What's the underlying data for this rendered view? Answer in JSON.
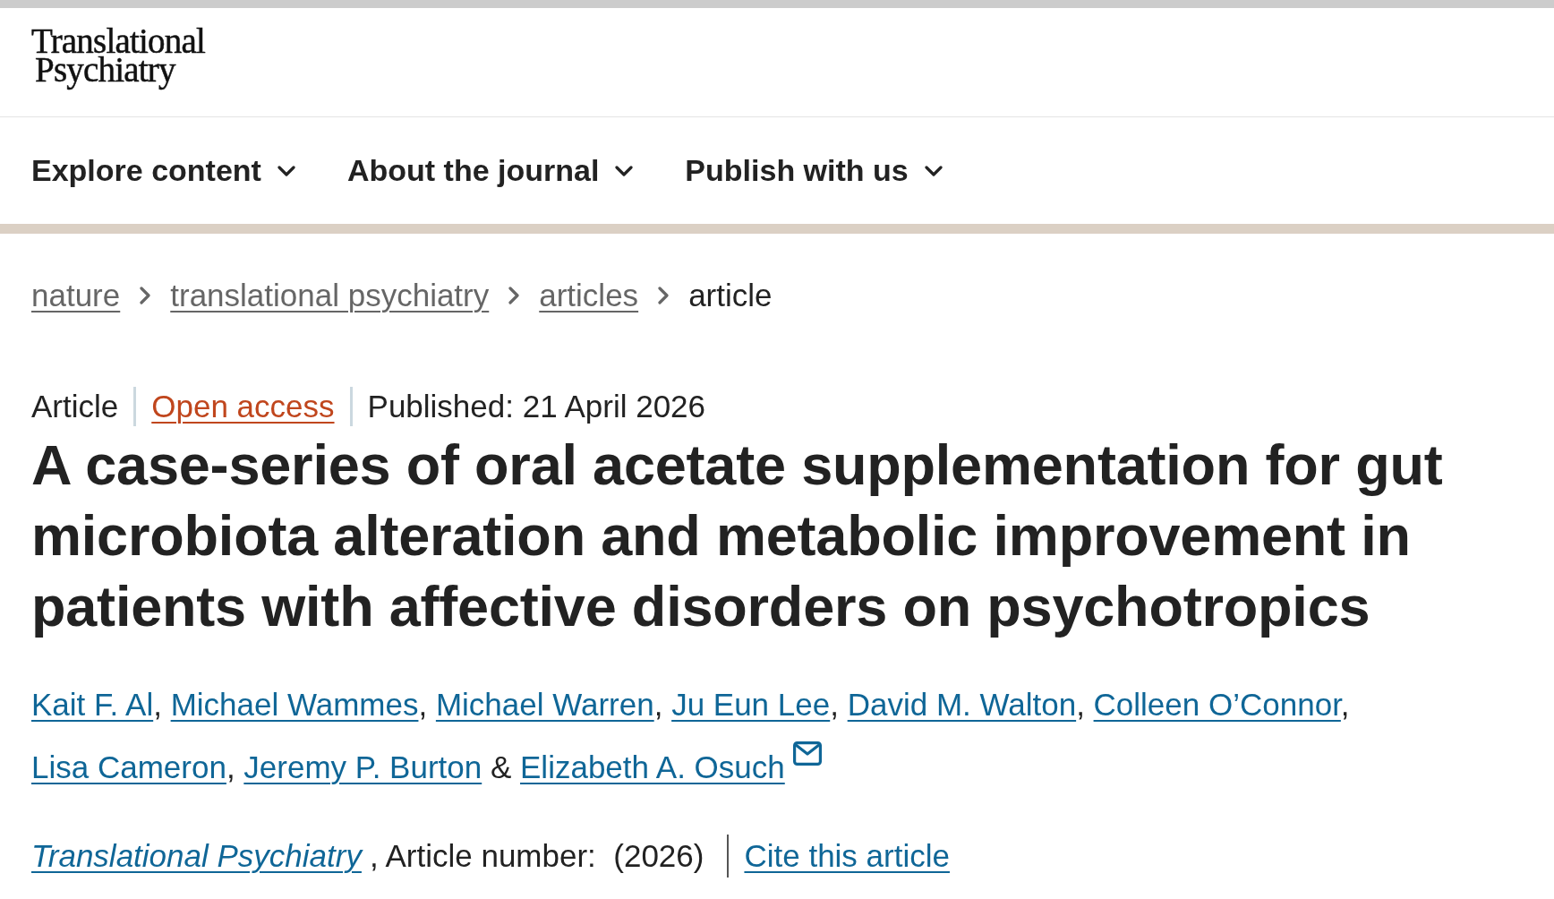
{
  "logo": {
    "lines": [
      "Translational",
      "Psychiatry"
    ]
  },
  "nav": [
    {
      "label": "Explore content",
      "expanded": false
    },
    {
      "label": "About the journal",
      "expanded": false
    },
    {
      "label": "Publish with us",
      "expanded": false
    }
  ],
  "breadcrumbs": [
    {
      "label": "nature",
      "current": false
    },
    {
      "label": "translational psychiatry",
      "current": false
    },
    {
      "label": "articles",
      "current": false
    },
    {
      "label": "article",
      "current": true
    }
  ],
  "article_meta": {
    "type": "Article",
    "access": "Open access",
    "published": "Published: 21 April 2026"
  },
  "title": "A case-series of oral acetate supplementation for gut microbiota alteration and metabolic improvement in patients with affective disorders on psychotropics",
  "authors": [
    {
      "name": "Kait F. Al",
      "separator": ", ",
      "corresponding": false
    },
    {
      "name": "Michael Wammes",
      "separator": ", ",
      "corresponding": false
    },
    {
      "name": "Michael Warren",
      "separator": ", ",
      "corresponding": false
    },
    {
      "name": "Ju Eun Lee",
      "separator": ", ",
      "corresponding": false
    },
    {
      "name": "David M. Walton",
      "separator": ", ",
      "corresponding": false
    },
    {
      "name": "Colleen O’Connor",
      "separator": ", ",
      "corresponding": false
    },
    {
      "name": "Lisa Cameron",
      "separator": ", ",
      "corresponding": false
    },
    {
      "name": "Jeremy P. Burton",
      "separator": " & ",
      "corresponding": false
    },
    {
      "name": "Elizabeth A. Osuch",
      "corresponding": true
    }
  ],
  "citation": {
    "journal": "Translational Psychiatry",
    "details": ", Article number:  (2026)",
    "cite_link": "Cite this article"
  }
}
